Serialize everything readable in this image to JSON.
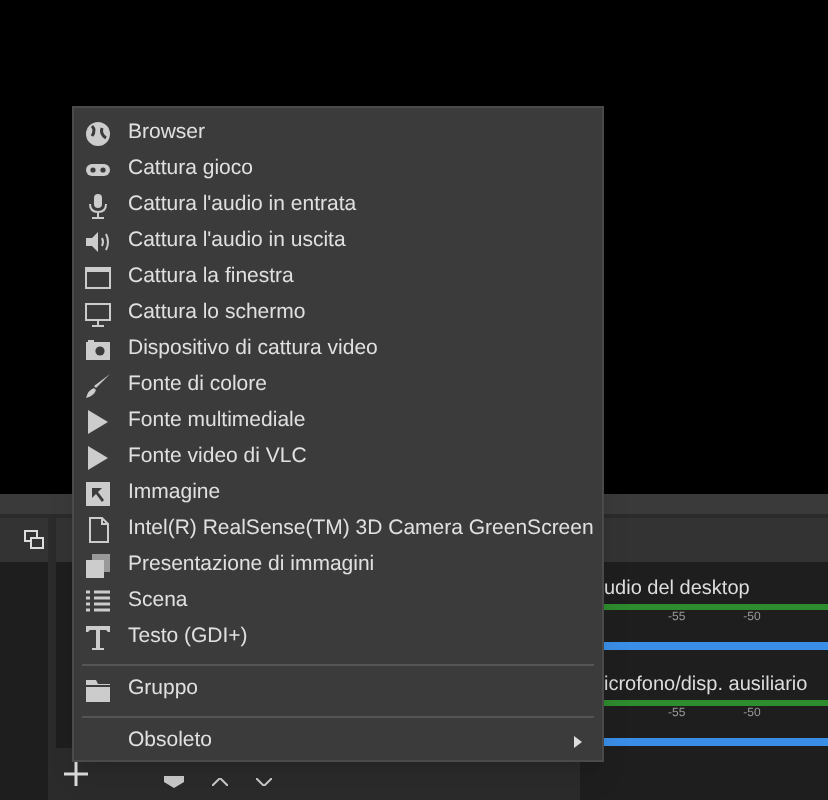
{
  "context_menu": {
    "sections": [
      [
        {
          "label": "Browser",
          "submenu": false
        },
        {
          "label": "Cattura gioco",
          "submenu": false
        },
        {
          "label": "Cattura l'audio in entrata",
          "submenu": false
        },
        {
          "label": "Cattura l'audio in uscita",
          "submenu": false
        },
        {
          "label": "Cattura la finestra",
          "submenu": false
        },
        {
          "label": "Cattura lo schermo",
          "submenu": false
        },
        {
          "label": "Dispositivo di cattura video",
          "submenu": false
        },
        {
          "label": "Fonte di colore",
          "submenu": false
        },
        {
          "label": "Fonte multimediale",
          "submenu": false
        },
        {
          "label": "Fonte video di VLC",
          "submenu": false
        },
        {
          "label": "Immagine",
          "submenu": false
        },
        {
          "label": "Intel(R) RealSense(TM) 3D Camera GreenScreen",
          "submenu": false
        },
        {
          "label": "Presentazione di immagini",
          "submenu": false
        },
        {
          "label": "Scena",
          "submenu": false
        },
        {
          "label": "Testo (GDI+)",
          "submenu": false
        }
      ],
      [
        {
          "label": "Gruppo",
          "submenu": false
        }
      ],
      [
        {
          "label": "Obsoleto",
          "submenu": true
        }
      ]
    ]
  },
  "audio_mixer": {
    "channels": [
      {
        "name": "udio del desktop",
        "ticks": [
          "-55",
          "-50"
        ],
        "level": 1,
        "volume": {
          "level": 1
        }
      },
      {
        "name": "icrofono/disp. ausiliario",
        "ticks": [
          "-55",
          "-50"
        ],
        "level": 1,
        "volume": {
          "level": 1
        }
      }
    ]
  }
}
